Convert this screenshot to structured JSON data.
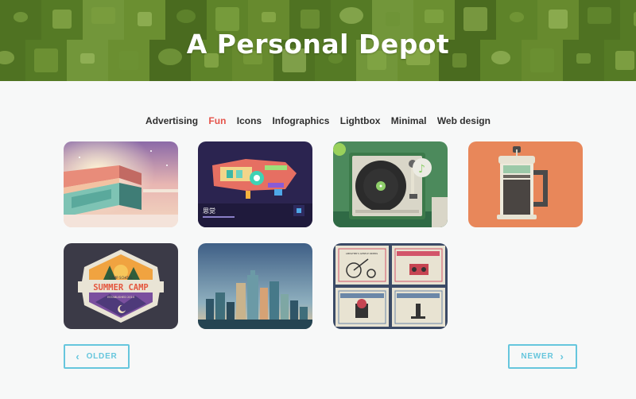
{
  "header": {
    "title": "A Personal Depot"
  },
  "nav": {
    "categories": [
      "Advertising",
      "Fun",
      "Icons",
      "Infographics",
      "Lightbox",
      "Minimal",
      "Web design"
    ],
    "active": "Fun"
  },
  "gallery": {
    "items": [
      {
        "name": "architecture-sunset-illustration"
      },
      {
        "name": "spaceship-illustration",
        "caption": "思觉"
      },
      {
        "name": "turntable-illustration"
      },
      {
        "name": "french-press-illustration"
      },
      {
        "name": "summer-camp-badge",
        "badge_small": "CAMP SCHOOL",
        "badge_title": "SUMMER CAMP",
        "badge_sub": "ESTABLISHED 2014"
      },
      {
        "name": "city-skyline-illustration"
      },
      {
        "name": "vintage-stamps-illustration",
        "stamp_labels": [
          "AMPLIFIER'S GENTLE RIDERS",
          "MASTERS OF BETTER SOUNDS",
          "CARTOGRAPHER'S CLUB",
          "BUDDY SYSTEM SCIENTISTS"
        ]
      }
    ]
  },
  "pagination": {
    "older_label": "OLDER",
    "newer_label": "NEWER"
  },
  "colors": {
    "accent": "#e5544b",
    "button": "#66c6dd",
    "header_green": "#5a7d22"
  }
}
